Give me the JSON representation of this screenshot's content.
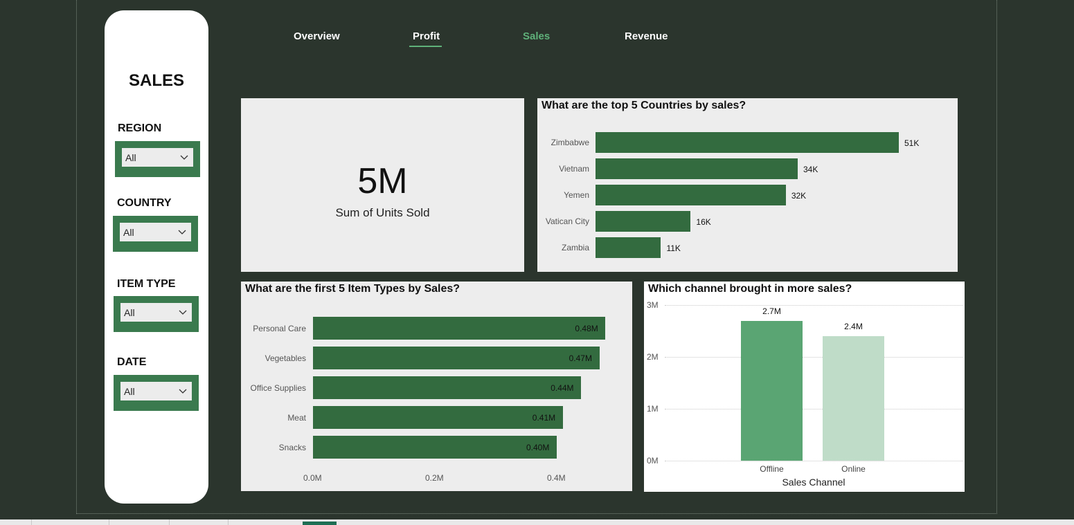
{
  "nav": {
    "tabs": [
      "Overview",
      "Profit",
      "Sales",
      "Revenue"
    ]
  },
  "sidebar": {
    "title": "SALES",
    "filters": [
      {
        "label": "REGION",
        "value": "All"
      },
      {
        "label": "COUNTRY",
        "value": "All"
      },
      {
        "label": "ITEM TYPE",
        "value": "All"
      },
      {
        "label": "DATE",
        "value": "All"
      }
    ]
  },
  "kpi": {
    "value": "5M",
    "label": "Sum of Units Sold"
  },
  "colors": {
    "background": "#2b352d",
    "bar": "#336b3f",
    "offline": "#5aa573",
    "online": "#bfdcc8",
    "active_tab": "#5fb17a"
  },
  "chart_data": [
    {
      "type": "bar",
      "orientation": "horizontal",
      "title": "What are the top 5 Countries by sales?",
      "categories": [
        "Zimbabwe",
        "Vietnam",
        "Yemen",
        "Vatican City",
        "Zambia"
      ],
      "values": [
        51,
        34,
        32,
        16,
        11
      ],
      "value_labels": [
        "51K",
        "34K",
        "32K",
        "16K",
        "11K"
      ]
    },
    {
      "type": "bar",
      "orientation": "horizontal",
      "title": "What are the first 5 Item Types by Sales?",
      "categories": [
        "Personal Care",
        "Vegetables",
        "Office Supplies",
        "Meat",
        "Snacks"
      ],
      "values": [
        0.48,
        0.47,
        0.44,
        0.41,
        0.4
      ],
      "value_labels": [
        "0.48M",
        "0.47M",
        "0.44M",
        "0.41M",
        "0.40M"
      ],
      "xticks": [
        "0.0M",
        "0.2M",
        "0.4M"
      ],
      "xlim": [
        0,
        0.5
      ],
      "grid": false
    },
    {
      "type": "bar",
      "title": "Which channel brought in more sales?",
      "categories": [
        "Offline",
        "Online"
      ],
      "values": [
        2.7,
        2.4
      ],
      "value_labels": [
        "2.7M",
        "2.4M"
      ],
      "xlabel": "Sales Channel",
      "yticks": [
        "0M",
        "1M",
        "2M",
        "3M"
      ],
      "ylim": [
        0,
        3
      ],
      "grid": true
    }
  ]
}
